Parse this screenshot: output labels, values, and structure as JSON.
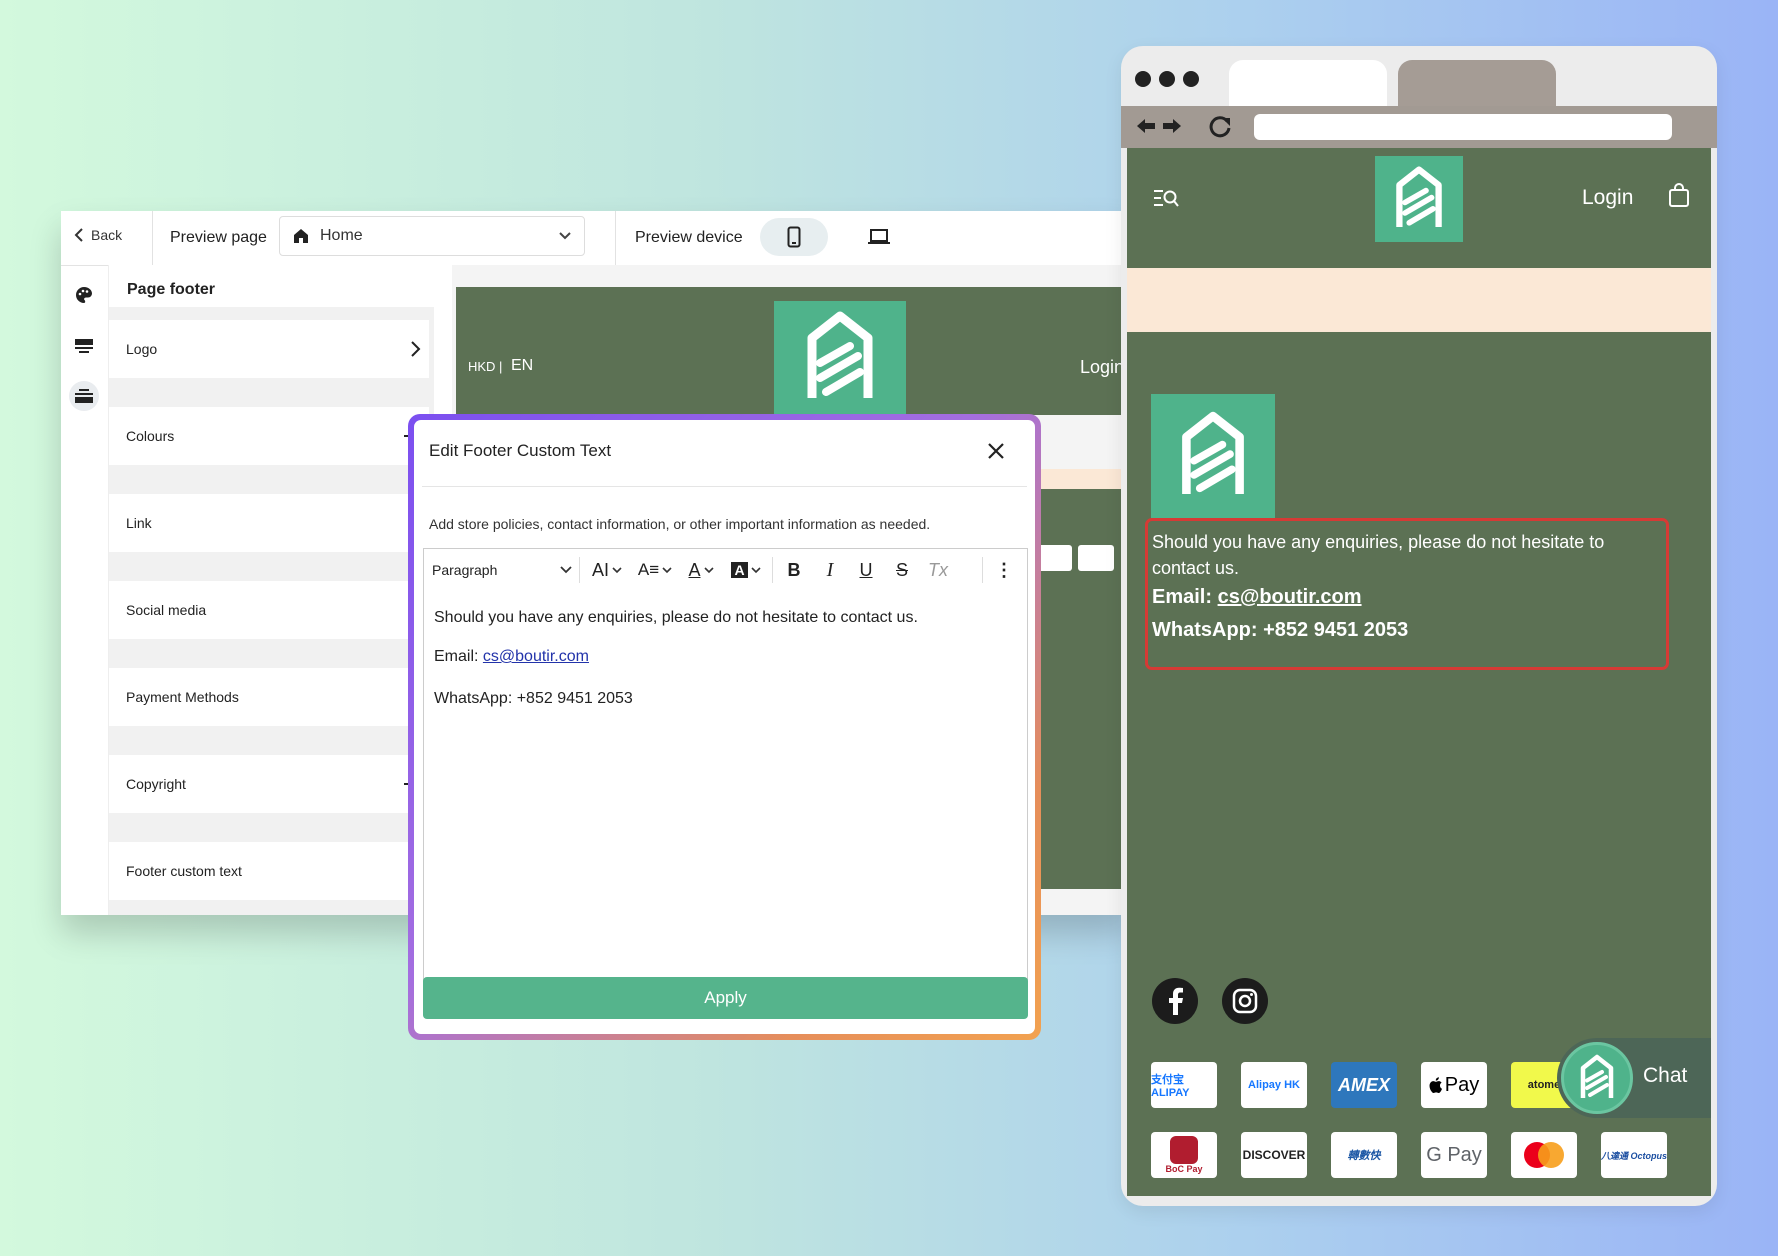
{
  "editor": {
    "back_label": "Back",
    "preview_page_label": "Preview page",
    "page_select_value": "Home",
    "preview_device_label": "Preview device",
    "sidebar_title": "Page footer",
    "sections": [
      {
        "label": "Logo",
        "action": "chevron"
      },
      {
        "label": "Colours",
        "action": "plus"
      },
      {
        "label": "Link",
        "action": "chevron"
      },
      {
        "label": "Social media",
        "action": "chevron"
      },
      {
        "label": "Payment Methods",
        "action": "chevron"
      },
      {
        "label": "Copyright",
        "action": "plus"
      },
      {
        "label": "Footer custom text",
        "action": "chevron"
      }
    ],
    "preview": {
      "currency": "HKD",
      "separator": "|",
      "language": "EN",
      "login": "Login"
    }
  },
  "modal": {
    "title": "Edit Footer Custom Text",
    "description": "Add store policies, contact information, or other important information as needed.",
    "toolbar": {
      "block_format": "Paragraph",
      "font_size_icon": "AI",
      "line_height_icon": "A≡",
      "text_color_icon": "A",
      "highlight_icon": "A",
      "bold": "B",
      "italic": "I",
      "underline": "U",
      "strikethrough": "S",
      "clear_format": "Tx",
      "more": "⋮"
    },
    "content": {
      "line1": "Should you have any enquiries, please do not hesitate to contact us.",
      "email_label": "Email: ",
      "email": "cs@boutir.com",
      "whatsapp": "WhatsApp: +852 9451 2053"
    },
    "apply_label": "Apply"
  },
  "mobile_preview": {
    "login": "Login",
    "footer_line1": "Should you have any enquiries, please do not hesitate to",
    "footer_line2": "contact us.",
    "email_label": "Email: ",
    "email": "cs@boutir.com",
    "whatsapp": "WhatsApp: +852 9451 2053",
    "payment_methods_row1": [
      "支付宝 ALIPAY",
      "Alipay HK",
      "AMEX",
      "Pay",
      "atome"
    ],
    "payment_methods_row2": [
      "BoC Pay",
      "DISCOVER",
      "轉數快",
      "G Pay",
      "mastercard",
      "八達通 Octopus"
    ],
    "chat_label": "Chat"
  },
  "colors": {
    "site_green": "#5c7154",
    "brand_green": "#4fb38b",
    "apply_green": "#55b48c",
    "peach": "#fbe8d6",
    "highlight_red": "#d63a35"
  }
}
